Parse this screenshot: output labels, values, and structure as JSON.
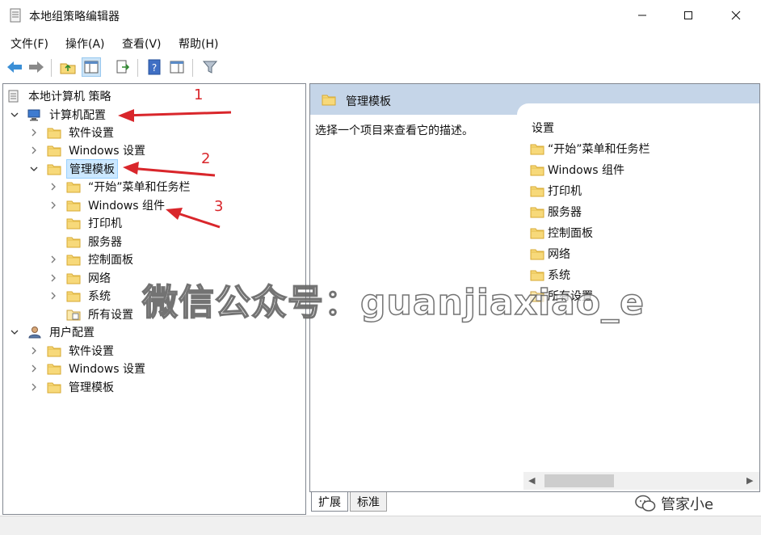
{
  "window": {
    "title": "本地组策略编辑器",
    "icon": "policy-document-icon",
    "controls": [
      "minimize-icon",
      "maximize-icon",
      "close-icon"
    ]
  },
  "menu": [
    {
      "label": "文件(F)"
    },
    {
      "label": "操作(A)"
    },
    {
      "label": "查看(V)"
    },
    {
      "label": "帮助(H)"
    }
  ],
  "toolbar": {
    "buttons": [
      "back-arrow-icon",
      "forward-arrow-icon",
      "up-folder-icon",
      "show-hide-tree-icon",
      "export-list-icon",
      "help-icon",
      "properties-icon",
      "filter-icon"
    ]
  },
  "tree": {
    "root": "本地计算机 策略",
    "computer_config": "计算机配置",
    "software_settings": "软件设置",
    "windows_settings": "Windows 设置",
    "admin_templates": "管理模板",
    "start_menu": "“开始”菜单和任务栏",
    "windows_components": "Windows 组件",
    "printers": "打印机",
    "server": "服务器",
    "control_panel": "控制面板",
    "network": "网络",
    "system": "系统",
    "all_settings": "所有设置",
    "user_config": "用户配置",
    "u_software_settings": "软件设置",
    "u_windows_settings": "Windows 设置",
    "u_admin_templates": "管理模板"
  },
  "details": {
    "header_title": "管理模板",
    "description": "选择一个项目来查看它的描述。",
    "column_header": "设置",
    "items": [
      {
        "label": "“开始”菜单和任务栏"
      },
      {
        "label": "Windows 组件"
      },
      {
        "label": "打印机"
      },
      {
        "label": "服务器"
      },
      {
        "label": "控制面板"
      },
      {
        "label": "网络"
      },
      {
        "label": "系统"
      },
      {
        "label": "所有设置"
      }
    ]
  },
  "tabs": {
    "extended": "扩展",
    "standard": "标准"
  },
  "annotations": {
    "n1": "1",
    "n2": "2",
    "n3": "3",
    "watermark": "微信公众号：guanjiaxiao_e",
    "brand": "管家小e",
    "arrow_color": "#d9262b"
  },
  "colors": {
    "selection": "#cce8ff",
    "header": "#c5d5e8",
    "folder": "#f5d56b"
  }
}
